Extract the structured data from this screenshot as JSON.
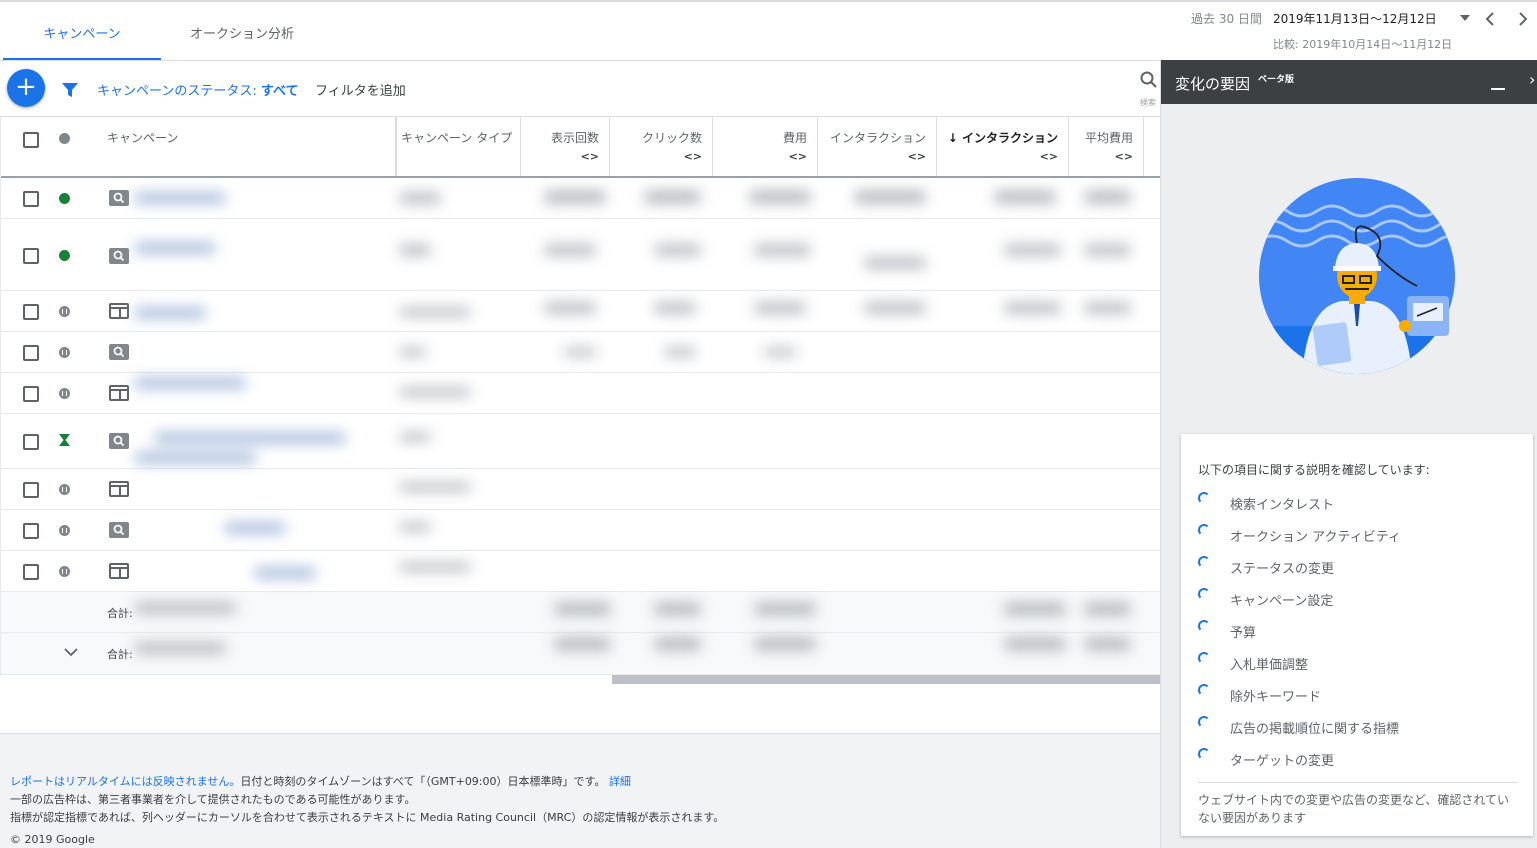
{
  "tabs": [
    "キャンペーン",
    "オークション分析"
  ],
  "date": {
    "label": "過去 30 日間",
    "range": "2019年11月13日～12月12日",
    "compare": "比較: 2019年10月14日～11月12日"
  },
  "toolbar": {
    "status_prefix": "キャンペーンのステータス: ",
    "status_value": "すべて",
    "add_filter": "フィルタを追加",
    "search_label": "検索"
  },
  "columns": {
    "campaign": "キャンペーン",
    "type": "キャンペーン タイプ",
    "impressions": "表示回数",
    "clicks": "クリック数",
    "cost": "費用",
    "interactions": "インタラクション",
    "interaction_rate": "↓ インタラクション",
    "avg_cost": "平均費用",
    "sort_glyph": "<>"
  },
  "rows": [
    {
      "status": "enabled",
      "type": "search"
    },
    {
      "status": "enabled",
      "type": "search"
    },
    {
      "status": "paused",
      "type": "display"
    },
    {
      "status": "paused",
      "type": "search"
    },
    {
      "status": "paused",
      "type": "display"
    },
    {
      "status": "pending",
      "type": "search"
    },
    {
      "status": "paused",
      "type": "display"
    },
    {
      "status": "paused",
      "type": "search"
    },
    {
      "status": "paused",
      "type": "display"
    }
  ],
  "totals": [
    "合計:",
    "合計:"
  ],
  "footer": {
    "line1_link": "レポートはリアルタイムには反映されません。",
    "line1_text": "日付と時刻のタイムゾーンはすべて「（GMT+09:00）日本標準時」です。",
    "line1_more": "詳細",
    "line2": "一部の広告枠は、第三者事業者を介して提供されたものである可能性があります。",
    "line3": "指標が認定指標であれば、列ヘッダーにカーソルを合わせて表示されるテキストに Media Rating Council（MRC）の認定情報が表示されます。",
    "copyright": "© 2019 Google"
  },
  "panel": {
    "title": "変化の要因",
    "beta": "ベータ版",
    "intro": "以下の項目に関する説明を確認しています:",
    "reasons": [
      "検索インタレスト",
      "オークション アクティビティ",
      "ステータスの変更",
      "キャンペーン設定",
      "予算",
      "入札単価調整",
      "除外キーワード",
      "広告の掲載順位に関する指標",
      "ターゲットの変更"
    ],
    "note": "ウェブサイト内での変更や広告の変更など、確認されていない要因があります"
  },
  "colors": {
    "accent": "#1a73e8",
    "enabled": "#188038",
    "panel_header": "#3c4043"
  }
}
